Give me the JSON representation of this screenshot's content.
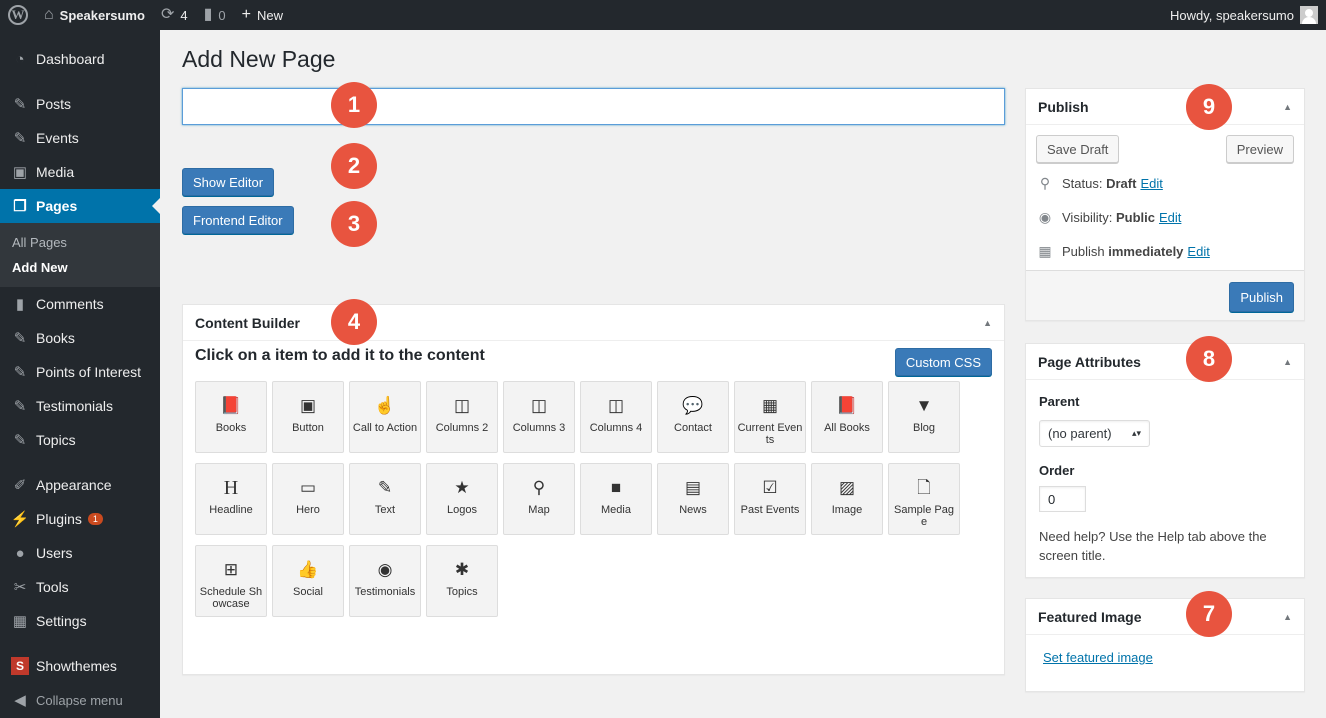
{
  "adminbar": {
    "site_name": "Speakersumo",
    "updates_count": "4",
    "comments_count": "0",
    "new_label": "New",
    "howdy": "Howdy, speakersumo"
  },
  "sidebar": {
    "items": [
      {
        "label": "Dashboard",
        "icon": "dashboard-icon"
      },
      {
        "label": "Posts",
        "icon": "pin-icon"
      },
      {
        "label": "Events",
        "icon": "pin-icon"
      },
      {
        "label": "Media",
        "icon": "media-icon"
      },
      {
        "label": "Pages",
        "icon": "pages-icon"
      },
      {
        "label": "Comments",
        "icon": "comment-icon"
      },
      {
        "label": "Books",
        "icon": "pin-icon"
      },
      {
        "label": "Points of Interest",
        "icon": "pin-icon"
      },
      {
        "label": "Testimonials",
        "icon": "pin-icon"
      },
      {
        "label": "Topics",
        "icon": "pin-icon"
      },
      {
        "label": "Appearance",
        "icon": "brush-icon"
      },
      {
        "label": "Plugins",
        "icon": "plug-icon",
        "badge": "1"
      },
      {
        "label": "Users",
        "icon": "user-icon"
      },
      {
        "label": "Tools",
        "icon": "wrench-icon"
      },
      {
        "label": "Settings",
        "icon": "settings-icon"
      },
      {
        "label": "Showthemes",
        "icon": "showthemes-icon"
      },
      {
        "label": "Collapse menu",
        "icon": "collapse-icon"
      }
    ],
    "pages_submenu": [
      "All Pages",
      "Add New"
    ]
  },
  "main": {
    "heading": "Add New Page",
    "title_value": "",
    "show_editor": "Show Editor",
    "frontend_editor": "Frontend Editor"
  },
  "content_builder": {
    "title": "Content Builder",
    "instruction": "Click on a item to add it to the content",
    "custom_css": "Custom CSS",
    "tiles": [
      {
        "label": "Books",
        "icon": "book-icon"
      },
      {
        "label": "Button",
        "icon": "button-icon"
      },
      {
        "label": "Call to Action",
        "icon": "hand-pointer-icon"
      },
      {
        "label": "Columns 2",
        "icon": "columns-icon"
      },
      {
        "label": "Columns 3",
        "icon": "columns-icon"
      },
      {
        "label": "Columns 4",
        "icon": "columns-icon"
      },
      {
        "label": "Contact",
        "icon": "chat-icon"
      },
      {
        "label": "Current Events",
        "icon": "calendar-icon"
      },
      {
        "label": "All Books",
        "icon": "book-icon"
      },
      {
        "label": "Blog",
        "icon": "bookmark-icon"
      },
      {
        "label": "Headline",
        "icon": "heading-icon"
      },
      {
        "label": "Hero",
        "icon": "window-icon"
      },
      {
        "label": "Text",
        "icon": "edit-icon"
      },
      {
        "label": "Logos",
        "icon": "star-icon"
      },
      {
        "label": "Map",
        "icon": "map-pin-icon"
      },
      {
        "label": "Media",
        "icon": "video-icon"
      },
      {
        "label": "News",
        "icon": "newspaper-icon"
      },
      {
        "label": "Past Events",
        "icon": "calendar-check-icon"
      },
      {
        "label": "Image",
        "icon": "image-icon"
      },
      {
        "label": "Sample Page",
        "icon": "file-icon"
      },
      {
        "label": "Schedule Showcase",
        "icon": "calendar-plus-icon"
      },
      {
        "label": "Social",
        "icon": "thumbs-up-icon"
      },
      {
        "label": "Testimonials",
        "icon": "user-circle-icon"
      },
      {
        "label": "Topics",
        "icon": "asterisk-icon"
      }
    ]
  },
  "publish": {
    "title": "Publish",
    "save_draft": "Save Draft",
    "preview": "Preview",
    "status_label": "Status:",
    "status_value": "Draft",
    "visibility_label": "Visibility:",
    "visibility_value": "Public",
    "publish_label": "Publish",
    "publish_value": "immediately",
    "edit": "Edit",
    "publish_button": "Publish"
  },
  "page_attributes": {
    "title": "Page Attributes",
    "parent_label": "Parent",
    "parent_value": "(no parent)",
    "order_label": "Order",
    "order_value": "0",
    "help": "Need help? Use the Help tab above the screen title."
  },
  "featured_image": {
    "title": "Featured Image",
    "link": "Set featured image"
  },
  "markers": [
    "1",
    "2",
    "3",
    "4",
    "7",
    "8",
    "9"
  ]
}
